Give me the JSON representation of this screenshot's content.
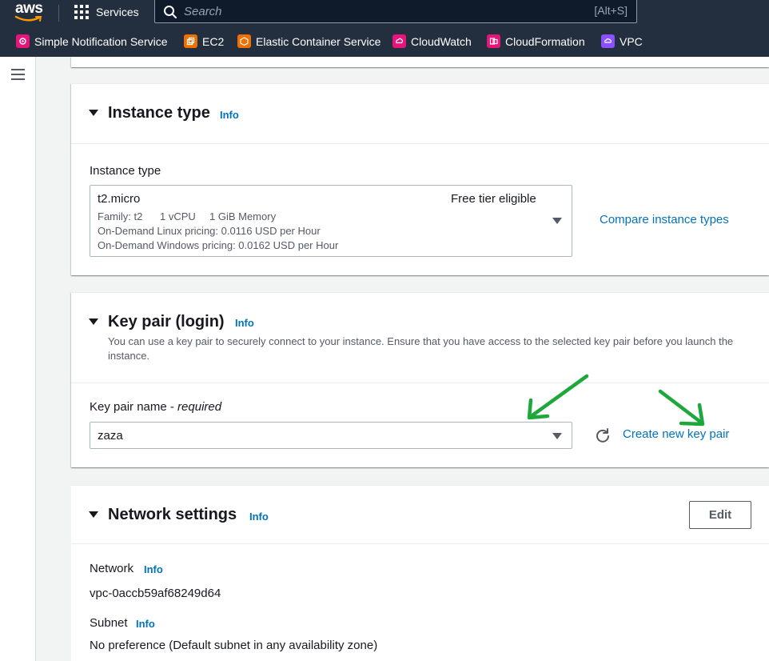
{
  "topnav": {
    "logo_text": "aws",
    "services_label": "Services",
    "search_placeholder": "Search",
    "search_shortcut": "[Alt+S]"
  },
  "favorites": [
    {
      "label": "Simple Notification Service",
      "icon": "sns-icon",
      "color": "#e7157b"
    },
    {
      "label": "EC2",
      "icon": "ec2-icon",
      "color": "#ed7100"
    },
    {
      "label": "Elastic Container Service",
      "icon": "ecs-icon",
      "color": "#ed7100"
    },
    {
      "label": "CloudWatch",
      "icon": "cloudwatch-icon",
      "color": "#e7157b"
    },
    {
      "label": "CloudFormation",
      "icon": "cloudformation-icon",
      "color": "#e7157b"
    },
    {
      "label": "VPC",
      "icon": "vpc-icon",
      "color": "#8c4fff"
    }
  ],
  "instance_type": {
    "title": "Instance type",
    "info": "Info",
    "field_label": "Instance type",
    "selected": "t2.micro",
    "badge": "Free tier eligible",
    "family": "Family: t2",
    "vcpu": "1 vCPU",
    "memory": "1 GiB Memory",
    "linux_pricing": "On-Demand Linux pricing: 0.0116 USD per Hour",
    "windows_pricing": "On-Demand Windows pricing: 0.0162 USD per Hour",
    "compare_link": "Compare instance types"
  },
  "key_pair": {
    "title": "Key pair (login)",
    "info": "Info",
    "description": "You can use a key pair to securely connect to your instance. Ensure that you have access to the selected key pair before you launch the instance.",
    "field_label": "Key pair name - ",
    "field_required": "required",
    "selected": "zaza",
    "create_link": "Create new key pair"
  },
  "network": {
    "title": "Network settings",
    "info": "Info",
    "edit_label": "Edit",
    "network_label": "Network",
    "network_info": "Info",
    "network_value": "vpc-0accb59af68249d64",
    "subnet_label": "Subnet",
    "subnet_info": "Info",
    "subnet_value": "No preference (Default subnet in any availability zone)"
  },
  "colors": {
    "nav_bg": "#232f3e",
    "link": "#0073bb",
    "annotation_arrow": "#1ea83c"
  }
}
